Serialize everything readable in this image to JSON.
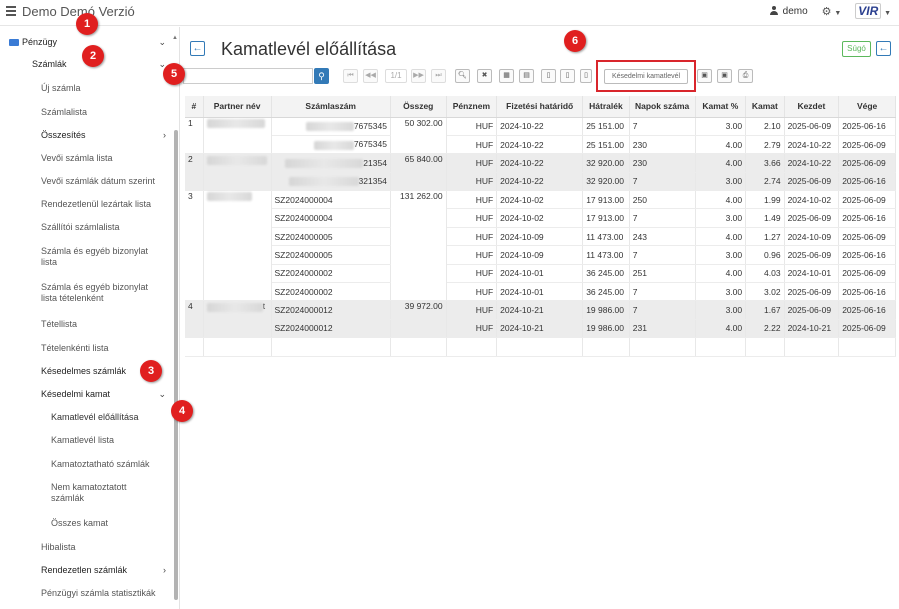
{
  "app": {
    "title": "Demo Demó Verzió",
    "user": "demo",
    "logo": "VIR"
  },
  "sidebar": {
    "penzugy": "Pénzügy",
    "szamlak": "Számlák",
    "items": [
      "Új számla",
      "Számlalista",
      "Összesítés",
      "Vevői számla lista",
      "Vevői számlák dátum szerint",
      "Rendezetlenül lezártak lista",
      "Szállítói számlalista",
      "Számla és egyéb bizonylat lista",
      "Számla és egyéb bizonylat lista tételenként",
      "Tétellista",
      "Tételenkénti lista",
      "Késedelmes számlák",
      "Késedelmi kamat",
      "Kamatlevél előállítása",
      "Kamatlevél lista",
      "Kamatoztatható számlák",
      "Nem kamatoztatott számlák",
      "Összes kamat",
      "Hibalista",
      "Rendezetlen számlák",
      "Pénzügyi számla statisztikák"
    ]
  },
  "page": {
    "title": "Kamatlevél előállítása",
    "help": "Súgó"
  },
  "toolbar": {
    "page_indicator": "1/1",
    "kesedelmi_btn": "Késedelmi kamatlevél"
  },
  "table": {
    "headers": [
      "#",
      "Partner név",
      "Számlaszám",
      "Összeg",
      "Pénznem",
      "Fizetési határidő",
      "Hátralék",
      "Napok száma",
      "Kamat %",
      "Kamat",
      "Kezdet",
      "Vége"
    ],
    "groups": [
      {
        "num": "1",
        "amount": "50 302.00",
        "rows": [
          {
            "inv": "7675345",
            "cur": "HUF",
            "due": "2024-10-22",
            "rem": "25 151.00",
            "days": "7",
            "pct": "3.00",
            "int": "2.10",
            "from": "2025-06-09",
            "to": "2025-06-16"
          },
          {
            "inv": "7675345",
            "cur": "HUF",
            "due": "2024-10-22",
            "rem": "25 151.00",
            "days": "230",
            "pct": "4.00",
            "int": "2.79",
            "from": "2024-10-22",
            "to": "2025-06-09"
          }
        ]
      },
      {
        "num": "2",
        "amount": "65 840.00",
        "rows": [
          {
            "inv": "21354",
            "cur": "HUF",
            "due": "2024-10-22",
            "rem": "32 920.00",
            "days": "230",
            "pct": "4.00",
            "int": "3.66",
            "from": "2024-10-22",
            "to": "2025-06-09"
          },
          {
            "inv": "321354",
            "cur": "HUF",
            "due": "2024-10-22",
            "rem": "32 920.00",
            "days": "7",
            "pct": "3.00",
            "int": "2.74",
            "from": "2025-06-09",
            "to": "2025-06-16"
          }
        ]
      },
      {
        "num": "3",
        "amount": "131 262.00",
        "rows": [
          {
            "inv": "SZ2024000004",
            "cur": "HUF",
            "due": "2024-10-02",
            "rem": "17 913.00",
            "days": "250",
            "pct": "4.00",
            "int": "1.99",
            "from": "2024-10-02",
            "to": "2025-06-09"
          },
          {
            "inv": "SZ2024000004",
            "cur": "HUF",
            "due": "2024-10-02",
            "rem": "17 913.00",
            "days": "7",
            "pct": "3.00",
            "int": "1.49",
            "from": "2025-06-09",
            "to": "2025-06-16"
          },
          {
            "inv": "SZ2024000005",
            "cur": "HUF",
            "due": "2024-10-09",
            "rem": "11 473.00",
            "days": "243",
            "pct": "4.00",
            "int": "1.27",
            "from": "2024-10-09",
            "to": "2025-06-09"
          },
          {
            "inv": "SZ2024000005",
            "cur": "HUF",
            "due": "2024-10-09",
            "rem": "11 473.00",
            "days": "7",
            "pct": "3.00",
            "int": "0.96",
            "from": "2025-06-09",
            "to": "2025-06-16"
          },
          {
            "inv": "SZ2024000002",
            "cur": "HUF",
            "due": "2024-10-01",
            "rem": "36 245.00",
            "days": "251",
            "pct": "4.00",
            "int": "4.03",
            "from": "2024-10-01",
            "to": "2025-06-09"
          },
          {
            "inv": "SZ2024000002",
            "cur": "HUF",
            "due": "2024-10-01",
            "rem": "36 245.00",
            "days": "7",
            "pct": "3.00",
            "int": "3.02",
            "from": "2025-06-09",
            "to": "2025-06-16"
          }
        ]
      },
      {
        "num": "4",
        "amount": "39 972.00",
        "partner_suffix": "t",
        "rows": [
          {
            "inv": "SZ2024000012",
            "cur": "HUF",
            "due": "2024-10-21",
            "rem": "19 986.00",
            "days": "7",
            "pct": "3.00",
            "int": "1.67",
            "from": "2025-06-09",
            "to": "2025-06-16"
          },
          {
            "inv": "SZ2024000012",
            "cur": "HUF",
            "due": "2024-10-21",
            "rem": "19 986.00",
            "days": "231",
            "pct": "4.00",
            "int": "2.22",
            "from": "2024-10-21",
            "to": "2025-06-09"
          }
        ]
      }
    ]
  },
  "markers": [
    "1",
    "2",
    "3",
    "4",
    "5",
    "6"
  ],
  "colors": {
    "accent": "#337ab7",
    "marker": "#e01f1f",
    "help": "#5cb85c"
  }
}
